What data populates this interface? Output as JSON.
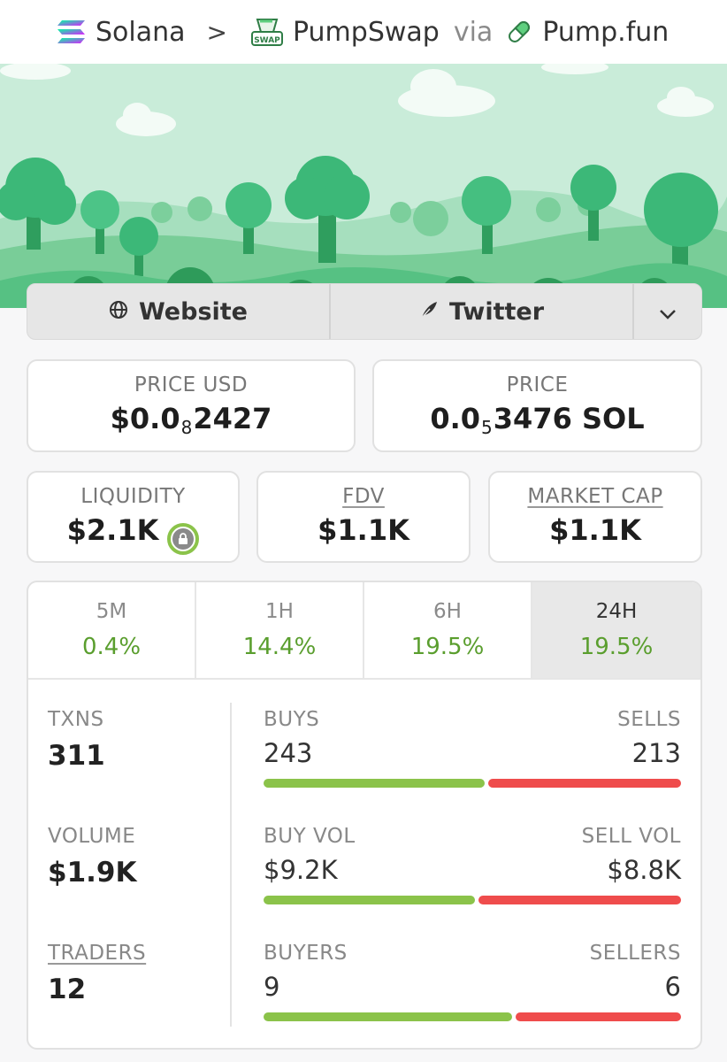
{
  "breadcrumb": {
    "chain": "Solana",
    "separator": ">",
    "dex": "PumpSwap",
    "dex_badge": "SWAP",
    "via": "via",
    "launchpad": "Pump.fun"
  },
  "links": {
    "website": "Website",
    "twitter": "Twitter"
  },
  "price_usd": {
    "label": "PRICE USD",
    "prefix": "$0.0",
    "zeros": "8",
    "digits": "2427"
  },
  "price_native": {
    "label": "PRICE",
    "prefix": "0.0",
    "zeros": "5",
    "digits": "3476 SOL"
  },
  "liquidity": {
    "label": "LIQUIDITY",
    "value": "$2.1K"
  },
  "fdv": {
    "label": "FDV",
    "value": "$1.1K"
  },
  "market_cap": {
    "label": "MARKET CAP",
    "value": "$1.1K"
  },
  "timeframes": [
    {
      "label": "5M",
      "change": "0.4%",
      "active": false
    },
    {
      "label": "1H",
      "change": "14.4%",
      "active": false
    },
    {
      "label": "6H",
      "change": "19.5%",
      "active": false
    },
    {
      "label": "24H",
      "change": "19.5%",
      "active": true
    }
  ],
  "stats": {
    "txns": {
      "label": "TXNS",
      "value": "311"
    },
    "volume": {
      "label": "VOLUME",
      "value": "$1.9K"
    },
    "traders": {
      "label": "TRADERS",
      "value": "12"
    },
    "buys": {
      "label": "BUYS",
      "value": "243"
    },
    "sells": {
      "label": "SELLS",
      "value": "213"
    },
    "buy_vol": {
      "label": "BUY VOL",
      "value": "$9.2K"
    },
    "sell_vol": {
      "label": "SELL VOL",
      "value": "$8.8K"
    },
    "buyers": {
      "label": "BUYERS",
      "value": "9"
    },
    "sellers": {
      "label": "SELLERS",
      "value": "6"
    },
    "buys_share": 0.533,
    "buy_vol_share": 0.511,
    "buyers_share": 0.6
  },
  "colors": {
    "positive": "#5a9e2e",
    "buy_bar": "#8bc34a",
    "sell_bar": "#ef4c4c",
    "banner_sky": "#c9ecd9",
    "tree": "#3cb878"
  },
  "icons": {
    "chain": "solana-icon",
    "dex": "pumpswap-icon",
    "launchpad": "pill-icon",
    "website": "globe-icon",
    "twitter": "feather-icon",
    "more": "chevron-down-icon",
    "liquidity_lock": "lock-icon"
  }
}
